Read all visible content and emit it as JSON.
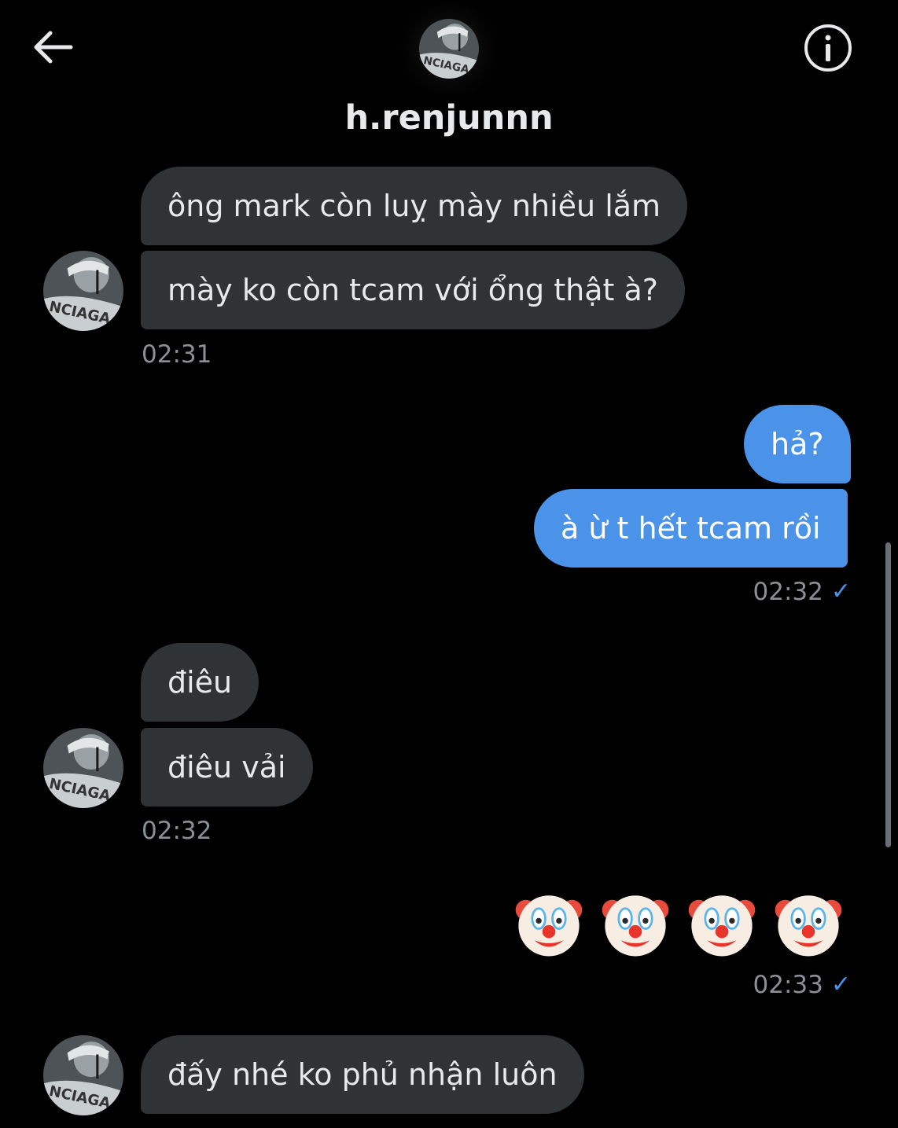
{
  "header": {
    "username": "h.renjunnn",
    "back_icon": "arrow-left-icon",
    "info_icon": "info-icon"
  },
  "messages": [
    {
      "side": "in",
      "text": "ông mark còn luỵ mày nhiều lắm"
    },
    {
      "side": "in",
      "text": "mày ko còn tcam với ổng thật à?"
    },
    {
      "side": "in-time",
      "text": "02:31"
    },
    {
      "side": "out",
      "text": "hả?"
    },
    {
      "side": "out",
      "text": "à ừ t hết tcam rồi"
    },
    {
      "side": "out-time",
      "text": "02:32"
    },
    {
      "side": "in",
      "text": "điêu"
    },
    {
      "side": "in",
      "text": "điêu vải"
    },
    {
      "side": "in-time",
      "text": "02:32"
    },
    {
      "side": "out",
      "text": "🤡🤡🤡🤡"
    },
    {
      "side": "out-time",
      "text": "02:33"
    },
    {
      "side": "in",
      "text": "đấy nhé ko phủ nhận luôn"
    }
  ],
  "colors": {
    "background": "#000000",
    "incoming_bubble": "#2f3336",
    "outgoing_bubble": "#4a93e8",
    "timestamp": "#8b9096",
    "read_check": "#4a93e8"
  }
}
